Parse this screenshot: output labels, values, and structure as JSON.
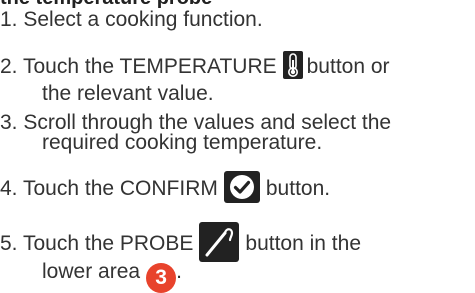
{
  "section": {
    "partial_heading": "the temperature probe"
  },
  "steps": [
    {
      "number": "1.",
      "text": "Select a cooking function."
    },
    {
      "number": "2.",
      "text_before": "Touch the TEMPERATURE",
      "icon": "thermometer-icon",
      "text_after": "button or",
      "text_line2": "the relevant value."
    },
    {
      "number": "3.",
      "text": "Scroll through the values and select the",
      "text_line2": "required cooking temperature."
    },
    {
      "number": "4.",
      "text_before": "Touch the CONFIRM",
      "icon": "checkmark-icon",
      "text_after": "button."
    },
    {
      "number": "5.",
      "text_before": "Touch the PROBE",
      "icon": "probe-icon",
      "text_after": "button in the",
      "text_line2": "lower area",
      "badge": "3",
      "text_end": "."
    }
  ],
  "colors": {
    "text": "#333333",
    "badge": "#e8432c",
    "icon_bg": "#222222"
  }
}
